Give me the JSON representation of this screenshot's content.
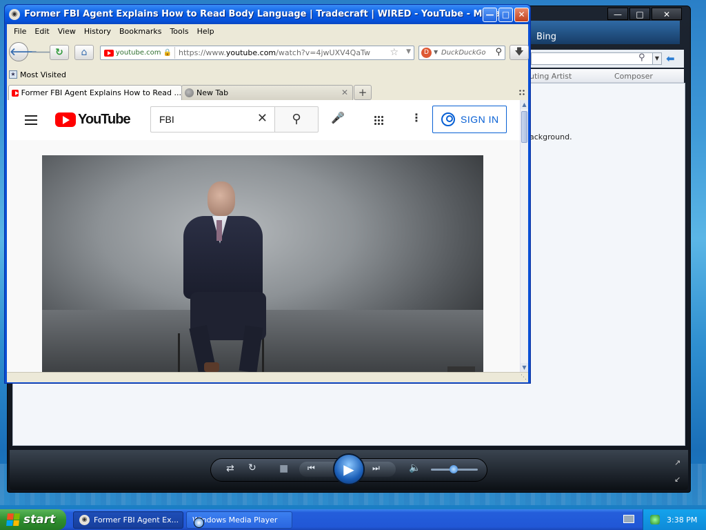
{
  "browser": {
    "title": "Former FBI Agent Explains How to Read Body Language  |  Tradecraft  |  WIRED - YouTube - Mypal",
    "menu": [
      "File",
      "Edit",
      "View",
      "History",
      "Bookmarks",
      "Tools",
      "Help"
    ],
    "url_site": "youtube.com",
    "url_prefix": "https://www.",
    "url_host": "youtube.com",
    "url_path": "/watch?v=4jwUXV4QaTw",
    "search_placeholder": "DuckDuckGo",
    "bookmarks_label": "Most Visited",
    "tabs": [
      {
        "label": "Former FBI Agent Explains How to Read ...",
        "active": true
      },
      {
        "label": "New Tab",
        "active": false
      }
    ]
  },
  "youtube": {
    "logo_text": "YouTube",
    "search_value": "FBI",
    "signin_label": "SIGN IN"
  },
  "wmp": {
    "bing_label": "Bing",
    "columns": [
      "uting Artist",
      "Composer"
    ],
    "bg_text": "ackground.",
    "volume_level": 0.48
  },
  "taskbar": {
    "start_label": "start",
    "tasks": [
      "Former FBI Agent Ex...",
      "Windows Media Player"
    ],
    "clock": "3:38 PM"
  },
  "colors": {
    "xp_blue": "#0a5ee6",
    "youtube_red": "#ff0000",
    "signin_blue": "#065fd4",
    "start_green": "#2f8f2f"
  }
}
